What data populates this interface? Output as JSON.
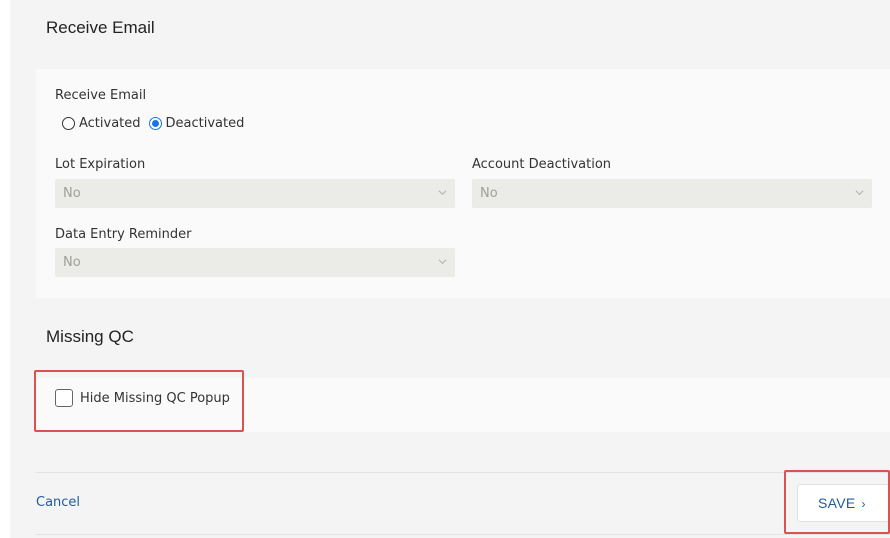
{
  "receive_email": {
    "section_title": "Receive Email",
    "field_label": "Receive Email",
    "options": [
      {
        "label": "Activated",
        "checked": false
      },
      {
        "label": "Deactivated",
        "checked": true
      }
    ],
    "lot_expiration": {
      "label": "Lot Expiration",
      "value": "No"
    },
    "account_deactivation": {
      "label": "Account Deactivation",
      "value": "No"
    },
    "data_entry_reminder": {
      "label": "Data Entry Reminder",
      "value": "No"
    }
  },
  "missing_qc": {
    "section_title": "Missing QC",
    "hide_popup_label": "Hide Missing QC Popup",
    "hide_popup_checked": false
  },
  "footer": {
    "cancel_label": "Cancel",
    "save_label": "SAVE",
    "save_arrow": "›"
  },
  "colors": {
    "accent": "#1a73e8",
    "link": "#1f5c9b",
    "highlight": "#d9534f"
  }
}
